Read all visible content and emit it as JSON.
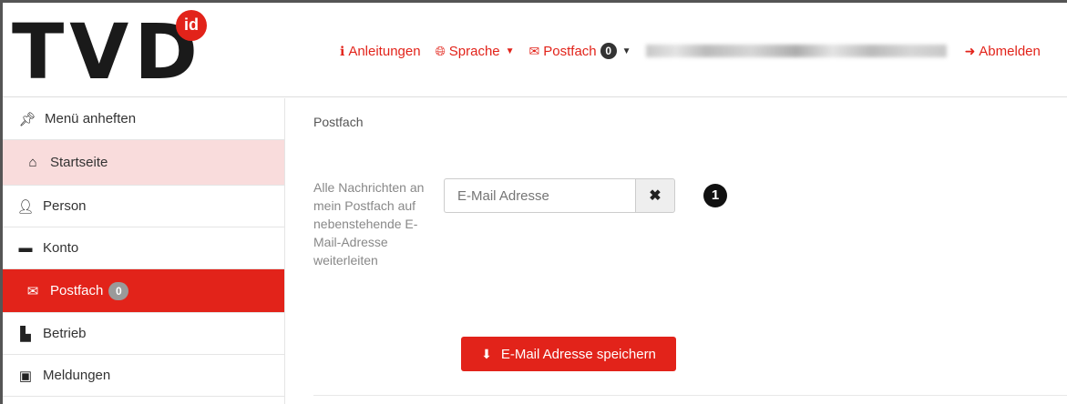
{
  "header": {
    "logo_text": "TVD",
    "logo_badge": "id",
    "nav": {
      "instructions_label": "Anleitungen",
      "language_label": "Sprache",
      "mailbox_label": "Postfach",
      "mailbox_count": "0",
      "logout_label": "Abmelden"
    }
  },
  "sidebar": {
    "items": [
      {
        "label": "Menü anheften",
        "icon": "pin-icon"
      },
      {
        "label": "Startseite",
        "icon": "home-icon"
      },
      {
        "label": "Person",
        "icon": "user-icon"
      },
      {
        "label": "Konto",
        "icon": "money-icon"
      },
      {
        "label": "Postfach",
        "icon": "envelope-icon",
        "badge": "0"
      },
      {
        "label": "Betrieb",
        "icon": "industry-icon"
      },
      {
        "label": "Meldungen",
        "icon": "clipboard-icon"
      }
    ]
  },
  "main": {
    "breadcrumb": "Postfach",
    "forward_description": "Alle Nachrichten an mein Postfach auf nebenstehende E-Mail-Adresse weiterleiten",
    "email_placeholder": "E-Mail Adresse",
    "email_value": "",
    "clear_symbol": "✖",
    "step_marker": "1",
    "save_button_label": "E-Mail Adresse speichern"
  },
  "colors": {
    "accent": "#e2231a",
    "home_highlight": "#f9dcdc",
    "text": "#333333"
  }
}
